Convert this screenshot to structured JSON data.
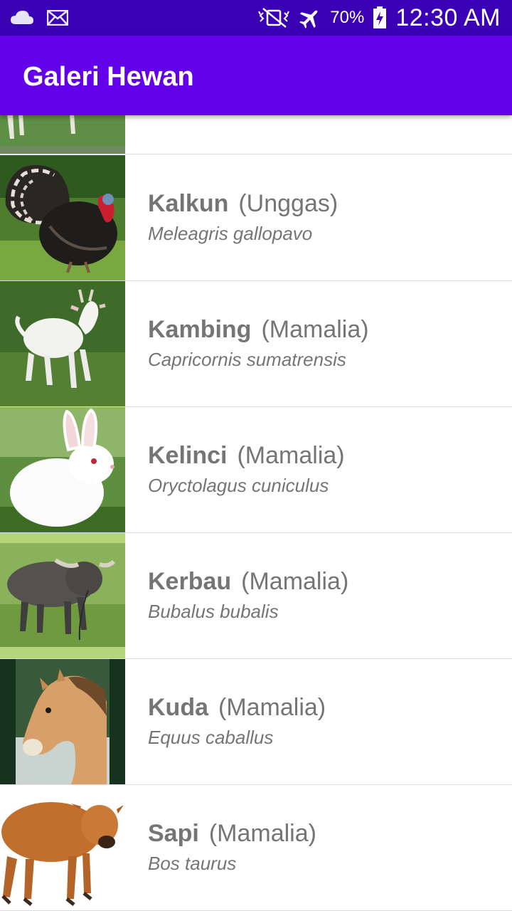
{
  "status_bar": {
    "battery": "70%",
    "time": "12:30 AM",
    "icons": [
      "cloud-icon",
      "mail-icon",
      "vibrate-mute-icon",
      "airplane-icon",
      "battery-charging-icon"
    ]
  },
  "app_bar": {
    "title": "Galeri Hewan"
  },
  "animals": [
    {
      "name": "Kalkun",
      "class": "(Unggas)",
      "latin": "Meleagris gallopavo"
    },
    {
      "name": "Kambing",
      "class": "(Mamalia)",
      "latin": "Capricornis sumatrensis"
    },
    {
      "name": "Kelinci",
      "class": "(Mamalia)",
      "latin": "Oryctolagus cuniculus"
    },
    {
      "name": "Kerbau",
      "class": "(Mamalia)",
      "latin": "Bubalus bubalis"
    },
    {
      "name": "Kuda",
      "class": "(Mamalia)",
      "latin": "Equus caballus"
    },
    {
      "name": "Sapi",
      "class": "(Mamalia)",
      "latin": "Bos taurus"
    }
  ],
  "colors": {
    "status_bar": "#3a00b3",
    "app_bar": "#6200ea",
    "text": "#757575",
    "divider": "#dcdcdc"
  }
}
